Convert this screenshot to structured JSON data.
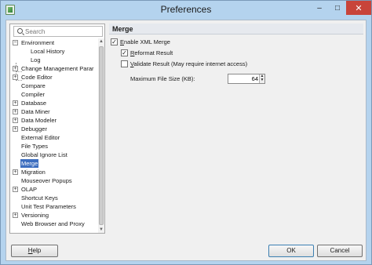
{
  "window": {
    "title": "Preferences",
    "minimize_glyph": "–",
    "maximize_glyph": "□",
    "close_glyph": "✕"
  },
  "search": {
    "placeholder": "Search"
  },
  "tree": {
    "items": [
      {
        "label": "Environment",
        "expander": "−"
      },
      {
        "label": "Local History",
        "expander": ""
      },
      {
        "label": "Log",
        "expander": ""
      },
      {
        "label": "Change Management Parar",
        "expander": "+"
      },
      {
        "label": "Code Editor",
        "expander": "+"
      },
      {
        "label": "Compare",
        "expander": ""
      },
      {
        "label": "Compiler",
        "expander": ""
      },
      {
        "label": "Database",
        "expander": "+"
      },
      {
        "label": "Data Miner",
        "expander": "+"
      },
      {
        "label": "Data Modeler",
        "expander": "+"
      },
      {
        "label": "Debugger",
        "expander": "+"
      },
      {
        "label": "External Editor",
        "expander": ""
      },
      {
        "label": "File Types",
        "expander": ""
      },
      {
        "label": "Global Ignore List",
        "expander": ""
      },
      {
        "label": "Merge",
        "expander": "",
        "selected": true
      },
      {
        "label": "Migration",
        "expander": "+"
      },
      {
        "label": "Mouseover Popups",
        "expander": ""
      },
      {
        "label": "OLAP",
        "expander": "+"
      },
      {
        "label": "Shortcut Keys",
        "expander": ""
      },
      {
        "label": "Unit Test Parameters",
        "expander": ""
      },
      {
        "label": "Versioning",
        "expander": "+"
      },
      {
        "label": "Web Browser and Proxy",
        "expander": ""
      }
    ]
  },
  "panel": {
    "title": "Merge",
    "enable_xml_merge": {
      "mnemonic": "E",
      "rest": "nable XML Merge",
      "checked": true
    },
    "reformat_result": {
      "mnemonic": "R",
      "rest": "eformat Result",
      "checked": true
    },
    "validate_result": {
      "mnemonic": "V",
      "rest": "alidate Result (May require internet access)",
      "checked": false
    },
    "max_file_size": {
      "label": "Maximum File Size (KB):",
      "value": "64"
    }
  },
  "footer": {
    "help": {
      "mnemonic": "H",
      "rest": "elp"
    },
    "ok": "OK",
    "cancel": "Cancel"
  }
}
